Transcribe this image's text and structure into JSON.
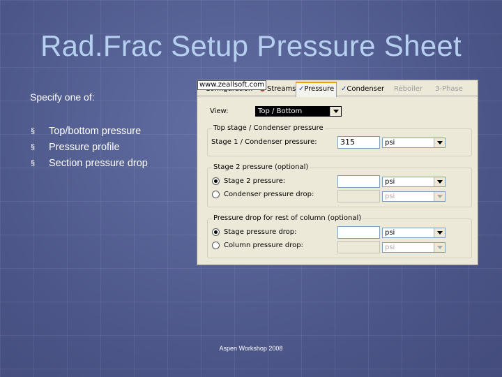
{
  "slide": {
    "title": "Rad.Frac Setup Pressure Sheet",
    "intro": "Specify one of:",
    "bullets": [
      {
        "marker": "§",
        "text": "Top/bottom pressure"
      },
      {
        "marker": "§",
        "text": "Pressure profile"
      },
      {
        "marker": "§",
        "text": "Section pressure drop"
      }
    ],
    "footer": "Aspen Workshop 2008"
  },
  "dialog": {
    "watermark": "www.zeallsoft.com",
    "tabs": [
      {
        "label": "Configuration",
        "check": "✓",
        "state": "normal"
      },
      {
        "label": "Streams",
        "check": "",
        "state": "normal",
        "icon": "stream-icon"
      },
      {
        "label": "Pressure",
        "check": "✓",
        "state": "active"
      },
      {
        "label": "Condenser",
        "check": "✓",
        "state": "normal"
      },
      {
        "label": "Reboiler",
        "check": "",
        "state": "disabled"
      },
      {
        "label": "3-Phase",
        "check": "",
        "state": "disabled"
      }
    ],
    "view": {
      "label": "View:",
      "value": "Top / Bottom"
    },
    "top_stage": {
      "legend": "Top stage / Condenser pressure",
      "label": "Stage 1 / Condenser pressure:",
      "value": "315",
      "unit": "psi"
    },
    "stage2": {
      "legend": "Stage 2 pressure (optional)",
      "options": [
        {
          "label": "Stage 2 pressure:",
          "selected": true,
          "value": "",
          "unit": "psi",
          "enabled": true
        },
        {
          "label": "Condenser pressure drop:",
          "selected": false,
          "value": "",
          "unit": "psi",
          "enabled": false
        }
      ]
    },
    "pressure_drop": {
      "legend": "Pressure drop for rest of column (optional)",
      "options": [
        {
          "label": "Stage pressure drop:",
          "selected": true,
          "value": "",
          "unit": "psi",
          "enabled": true
        },
        {
          "label": "Column pressure drop:",
          "selected": false,
          "value": "",
          "unit": "psi",
          "enabled": false
        }
      ]
    }
  },
  "colors": {
    "background": "#4f5a8e",
    "title": "#b6d1ef",
    "dialog": "#ece9d8",
    "active_tab_accent": "#f2a000"
  }
}
